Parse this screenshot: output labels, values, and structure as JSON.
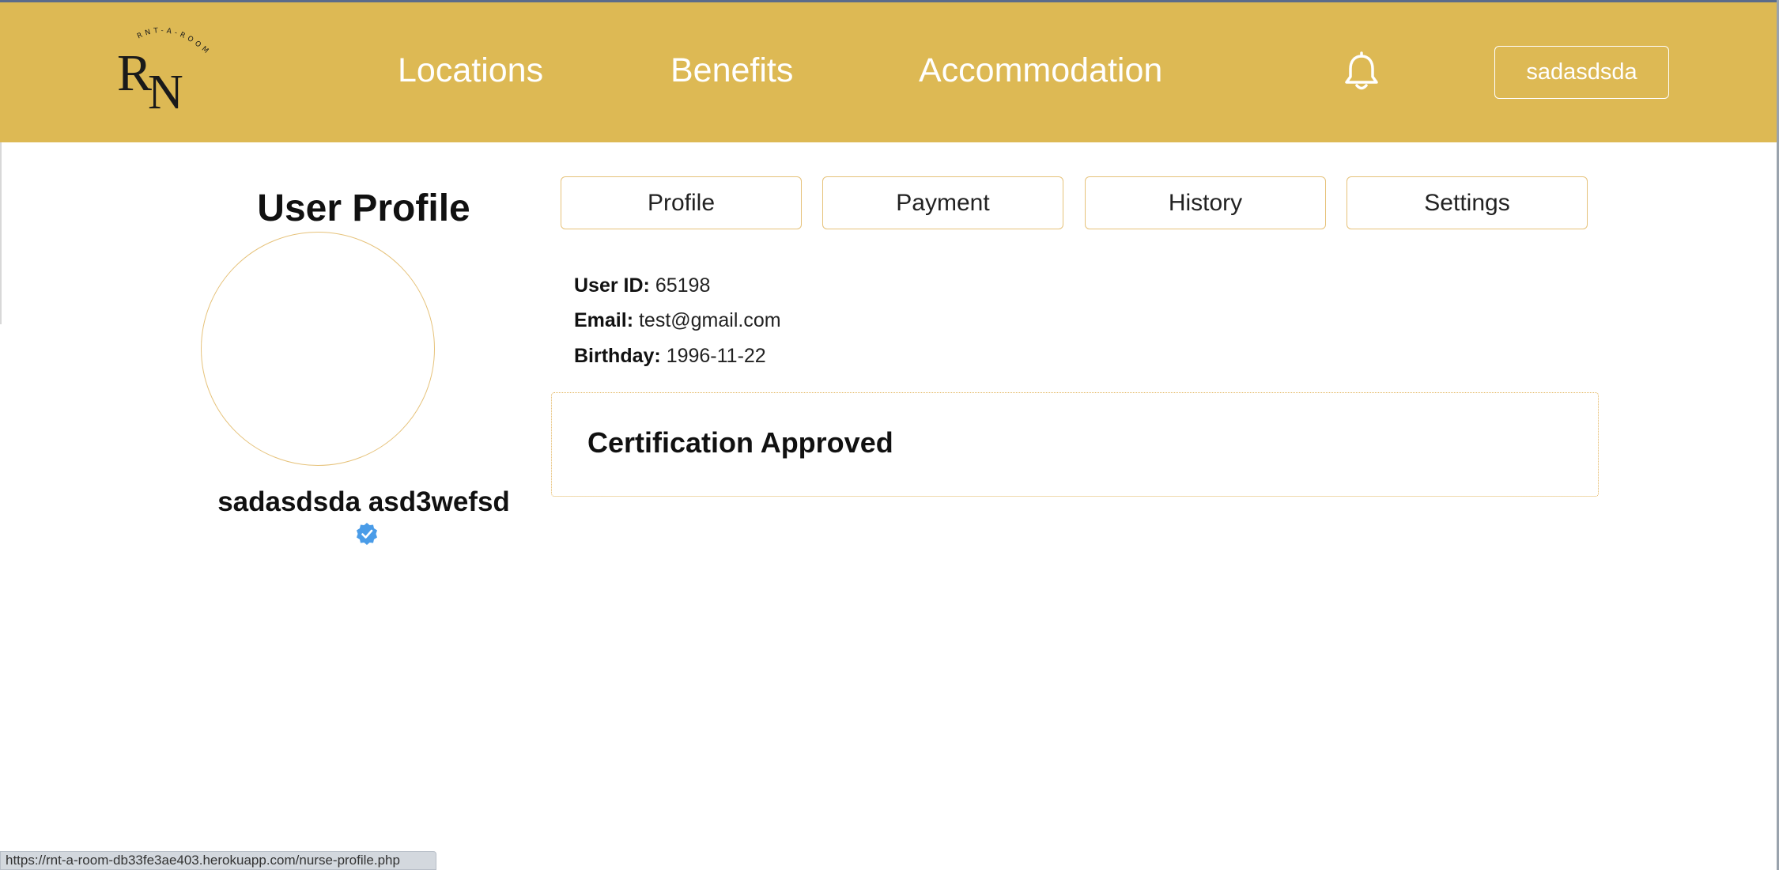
{
  "header": {
    "logo": {
      "letters": "RN",
      "arc_text": "RNT-A-ROOM",
      "icon": "rnt-a-room-logo"
    },
    "nav": [
      {
        "label": "Locations"
      },
      {
        "label": "Benefits"
      },
      {
        "label": "Accommodation"
      }
    ],
    "bell_icon": "bell-icon",
    "user_button_label": "sadasdsda",
    "background_color": "#ddb954"
  },
  "sidebar": {
    "title": "User Profile",
    "full_name": "sadasdsda asd3wefsd",
    "verified_icon": "verified-badge-icon"
  },
  "tabs": [
    {
      "label": "Profile"
    },
    {
      "label": "Payment"
    },
    {
      "label": "History"
    },
    {
      "label": "Settings"
    }
  ],
  "info": {
    "user_id_label": "User ID:",
    "user_id_value": "65198",
    "email_label": "Email:",
    "email_value": "test@gmail.com",
    "birthday_label": "Birthday:",
    "birthday_value": "1996-11-22"
  },
  "certification": {
    "status_text": "Certification Approved"
  },
  "status_bar": {
    "url": "https://rnt-a-room-db33fe3ae403.herokuapp.com/nurse-profile.php"
  },
  "colors": {
    "accent": "#ddb954",
    "border": "#e6c27a",
    "verified": "#4a9ce8"
  }
}
